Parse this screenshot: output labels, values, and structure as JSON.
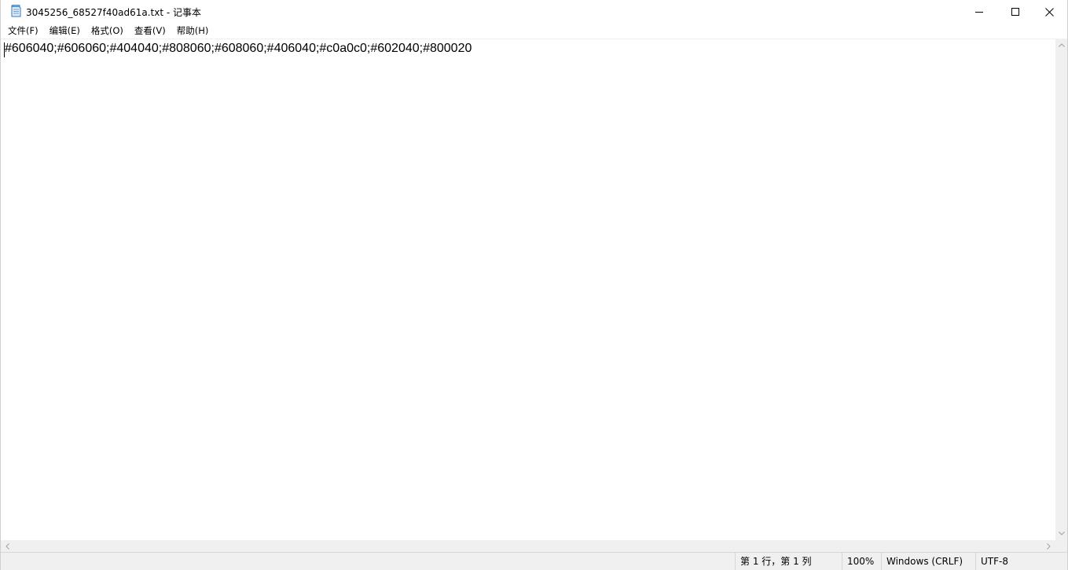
{
  "window": {
    "title": "3045256_68527f40ad61a.txt - 记事本",
    "icon": "notepad-icon",
    "controls": {
      "minimize": "minimize-icon",
      "maximize": "maximize-icon",
      "close": "close-icon"
    }
  },
  "menu": [
    {
      "label": "文件(F)"
    },
    {
      "label": "编辑(E)"
    },
    {
      "label": "格式(O)"
    },
    {
      "label": "查看(V)"
    },
    {
      "label": "帮助(H)"
    }
  ],
  "editor": {
    "content": "#606040;#606060;#404040;#808060;#608060;#406040;#c0a0c0;#602040;#800020"
  },
  "status": {
    "position": "第 1 行，第 1 列",
    "zoom": "100%",
    "line_ending": "Windows (CRLF)",
    "encoding": "UTF-8"
  },
  "colors": {
    "chrome": "#f0f0f0",
    "text": "#000000",
    "background": "#ffffff"
  }
}
